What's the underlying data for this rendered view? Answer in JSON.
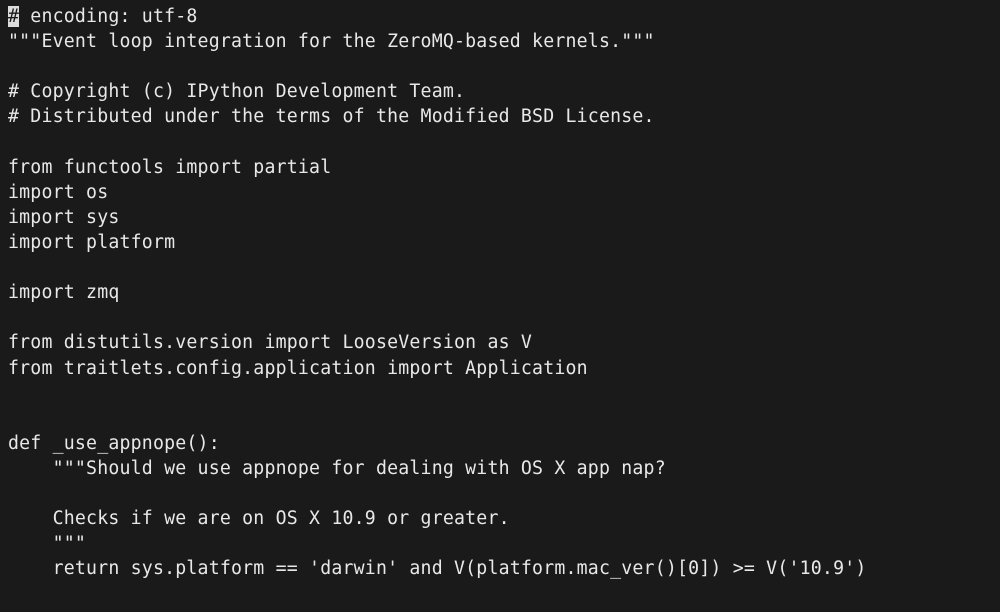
{
  "code": {
    "cursor_char": "#",
    "lines": [
      " encoding: utf-8",
      "\"\"\"Event loop integration for the ZeroMQ-based kernels.\"\"\"",
      "",
      "# Copyright (c) IPython Development Team.",
      "# Distributed under the terms of the Modified BSD License.",
      "",
      "from functools import partial",
      "import os",
      "import sys",
      "import platform",
      "",
      "import zmq",
      "",
      "from distutils.version import LooseVersion as V",
      "from traitlets.config.application import Application",
      "",
      "",
      "def _use_appnope():",
      "    \"\"\"Should we use appnope for dealing with OS X app nap?",
      "",
      "    Checks if we are on OS X 10.9 or greater.",
      "    \"\"\"",
      "    return sys.platform == 'darwin' and V(platform.mac_ver()[0]) >= V('10.9')"
    ]
  }
}
